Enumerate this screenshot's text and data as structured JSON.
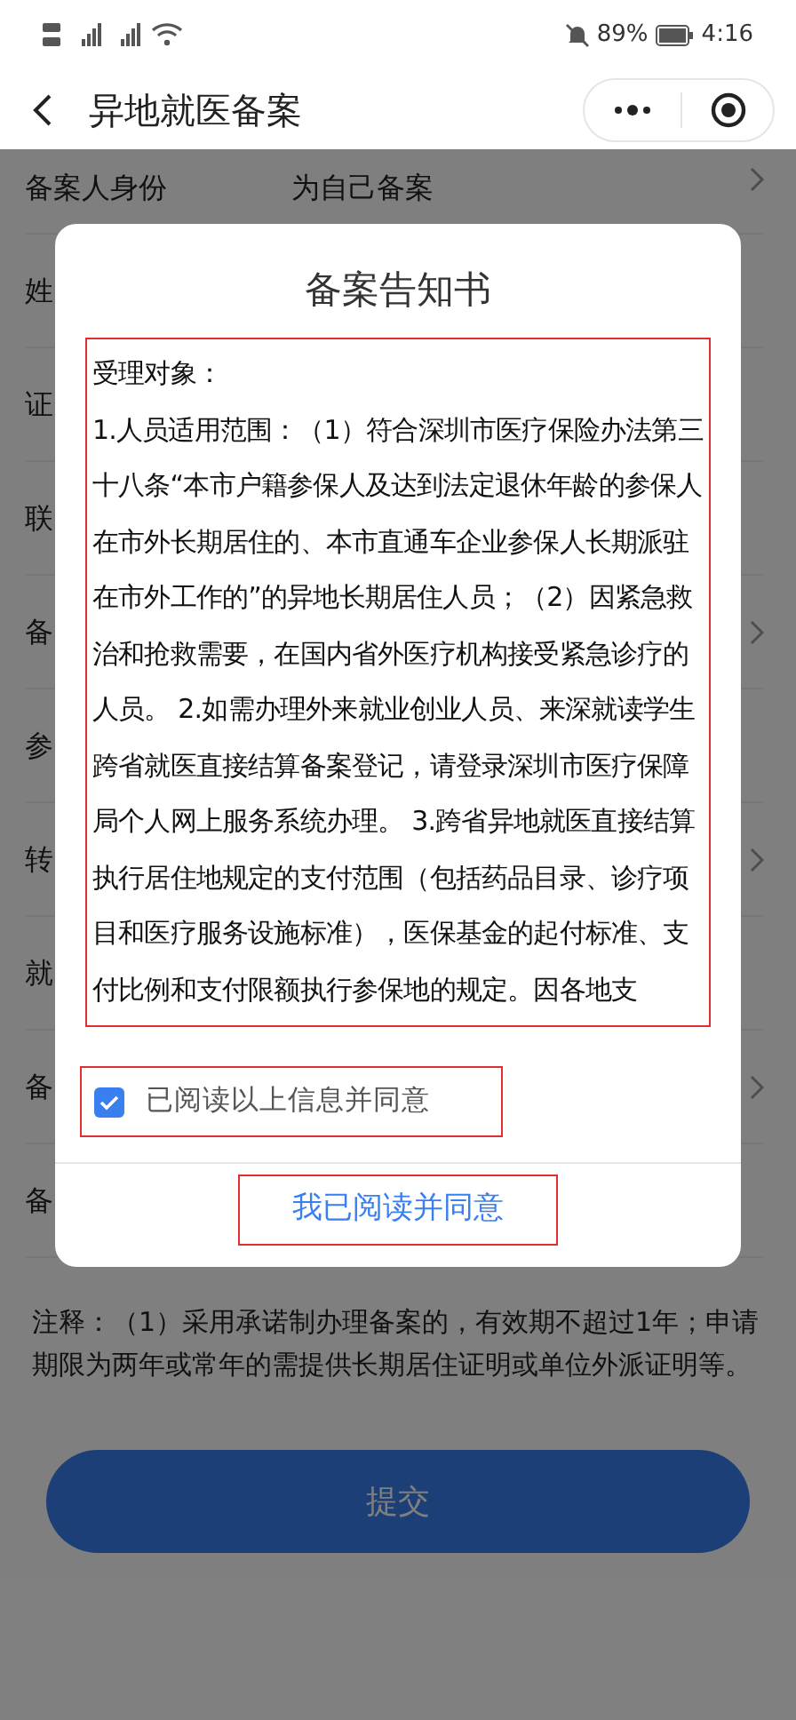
{
  "status_bar": {
    "battery": "89%",
    "time": "4:16"
  },
  "nav": {
    "title": "异地就医备案"
  },
  "form": {
    "rows": [
      {
        "label": "备案人身份",
        "value": "为自己备案",
        "chevron": true
      },
      {
        "label": "姓",
        "chevron": false
      },
      {
        "label": "证",
        "chevron": false
      },
      {
        "label": "联",
        "chevron": false
      },
      {
        "label": "备",
        "chevron": true
      },
      {
        "label": "参",
        "chevron": false
      },
      {
        "label": "转",
        "chevron": true
      },
      {
        "label": "就",
        "chevron": false
      },
      {
        "label": "备",
        "chevron": true
      },
      {
        "label": "备",
        "chevron": false
      }
    ]
  },
  "note": "注释：（1）采用承诺制办理备案的，有效期不超过1年；申请期限为两年或常年的需提供长期居住证明或单位外派证明等。",
  "submit_button": {
    "label": "提交"
  },
  "dialog": {
    "title": "备案告知书",
    "paragraphs": [
      "受理对象：",
      "1.人员适用范围：（1）符合深圳市医疗保险办法第三十八条“本市户籍参保人及达到法定退休年龄的参保人在市外长期居住的、本市直通车企业参保人长期派驻在市外工作的”的异地长期居住人员；（2）因紧急救治和抢救需要，在国内省外医疗机构接受紧急诊疗的人员。 2.如需办理外来就业创业人员、来深就读学生跨省就医直接结算备案登记，请登录深圳市医疗保障局个人网上服务系统办理。 3.跨省异地就医直接结算执行居住地规定的支付范围（包括药品目录、诊疗项目和医疗服务设施标准），医保基金的起付标准、支付比例和支付限额执行参保地的规定。因各地支"
    ],
    "agree_checkbox": {
      "label": "已阅读以上信息并同意",
      "checked": true
    },
    "confirm_button": {
      "label": "我已阅读并同意"
    }
  }
}
